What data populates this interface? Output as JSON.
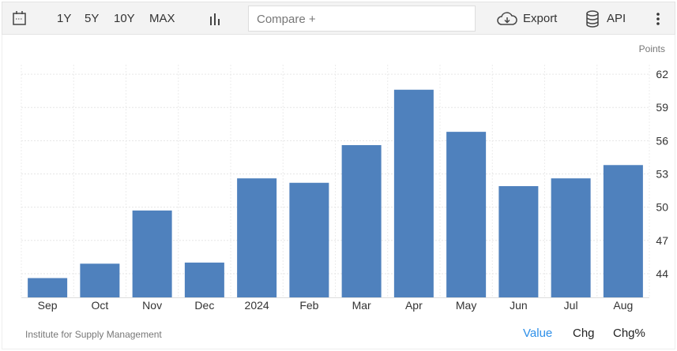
{
  "toolbar": {
    "ranges": [
      "1Y",
      "5Y",
      "10Y",
      "MAX"
    ],
    "compare_placeholder": "Compare +",
    "export_label": "Export",
    "api_label": "API"
  },
  "footer": {
    "source": "Institute for Supply Management",
    "tabs": [
      "Value",
      "Chg",
      "Chg%"
    ]
  },
  "colors": {
    "bar": "#4f81bd",
    "active": "#2d8fe8"
  },
  "chart_data": {
    "type": "bar",
    "title": "",
    "xlabel": "",
    "ylabel": "Points",
    "categories": [
      "Sep",
      "Oct",
      "Nov",
      "Dec",
      "2024",
      "Feb",
      "Mar",
      "Apr",
      "May",
      "Jun",
      "Jul",
      "Aug"
    ],
    "values": [
      43.6,
      44.9,
      49.7,
      45.0,
      52.6,
      52.2,
      55.6,
      60.6,
      56.8,
      51.9,
      52.6,
      53.8
    ],
    "yticks": [
      44,
      47,
      50,
      53,
      56,
      59,
      62
    ],
    "ylim": [
      41.86,
      62.86
    ],
    "grid": true
  }
}
